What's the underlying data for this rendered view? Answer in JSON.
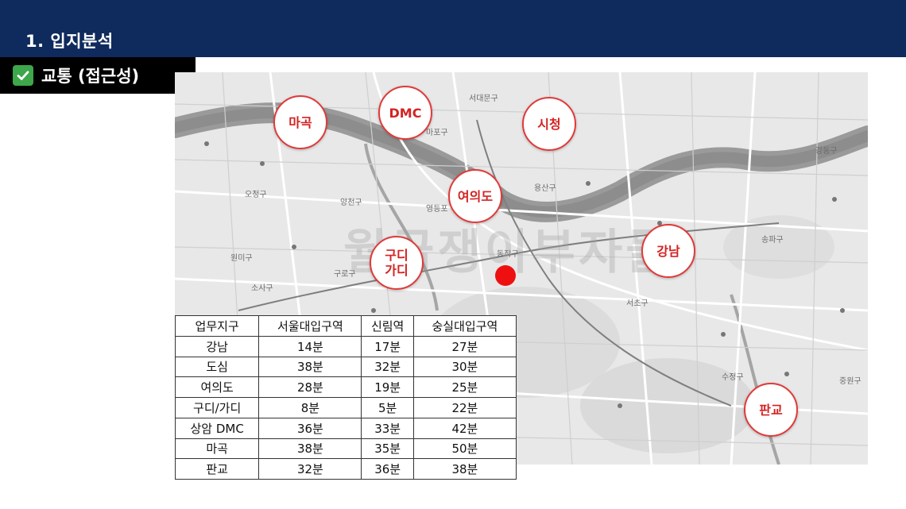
{
  "header": {
    "title": "1. 입지분석"
  },
  "section": {
    "label": "교통 (접근성)",
    "check_color": "#3ea64b"
  },
  "map": {
    "watermark": "월급쟁이부자들",
    "zones": [
      {
        "id": "mapo",
        "label": "마곡"
      },
      {
        "id": "dmc",
        "label": "DMC"
      },
      {
        "id": "cityhall",
        "label": "시청"
      },
      {
        "id": "yeouido",
        "label": "여의도"
      },
      {
        "id": "gurodigital",
        "label": "구디\n가디"
      },
      {
        "id": "gangnam",
        "label": "강남"
      },
      {
        "id": "pangyo",
        "label": "판교"
      }
    ],
    "district_labels": [
      "서대문구",
      "마포구",
      "용산구",
      "양천구",
      "오정구",
      "영등포",
      "동작구",
      "원미구",
      "구로구",
      "소사구",
      "서초구",
      "송파구",
      "강동구",
      "수정구",
      "중원구"
    ]
  },
  "table": {
    "headers": [
      "업무지구",
      "서울대입구역",
      "신림역",
      "숭실대입구역"
    ],
    "rows": [
      [
        "강남",
        "14분",
        "17분",
        "27분"
      ],
      [
        "도심",
        "38분",
        "32분",
        "30분"
      ],
      [
        "여의도",
        "28분",
        "19분",
        "25분"
      ],
      [
        "구디/가디",
        "8분",
        "5분",
        "22분"
      ],
      [
        "상암 DMC",
        "36분",
        "33분",
        "42분"
      ],
      [
        "마곡",
        "38분",
        "35분",
        "50분"
      ],
      [
        "판교",
        "32분",
        "36분",
        "38분"
      ]
    ]
  }
}
